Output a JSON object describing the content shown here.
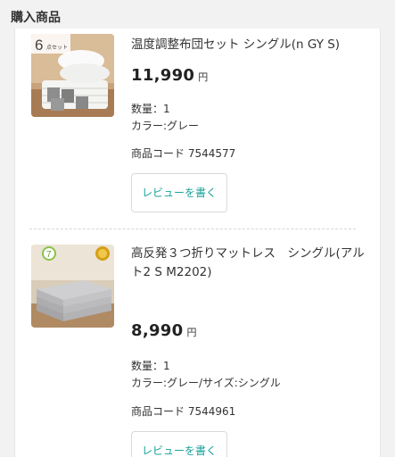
{
  "section": {
    "title": "購入商品"
  },
  "items": [
    {
      "name": "温度調整布団セット シングル(n GY S)",
      "price": "11,990",
      "yen": "円",
      "quantity": "数量：1",
      "variant": "カラー:グレー",
      "code": "商品コード 7544577",
      "review_label": "レビューを書く",
      "image_badge_number": "6",
      "image_badge_text": "点セット"
    },
    {
      "name": "高反発３つ折りマットレス　シングル(アルト2 S M2202)",
      "price": "8,990",
      "yen": "円",
      "quantity": "数量：1",
      "variant": "カラー:グレー/サイズ:シングル",
      "code": "商品コード 7544961",
      "review_label": "レビューを書く",
      "image_badge_number": "7"
    }
  ]
}
